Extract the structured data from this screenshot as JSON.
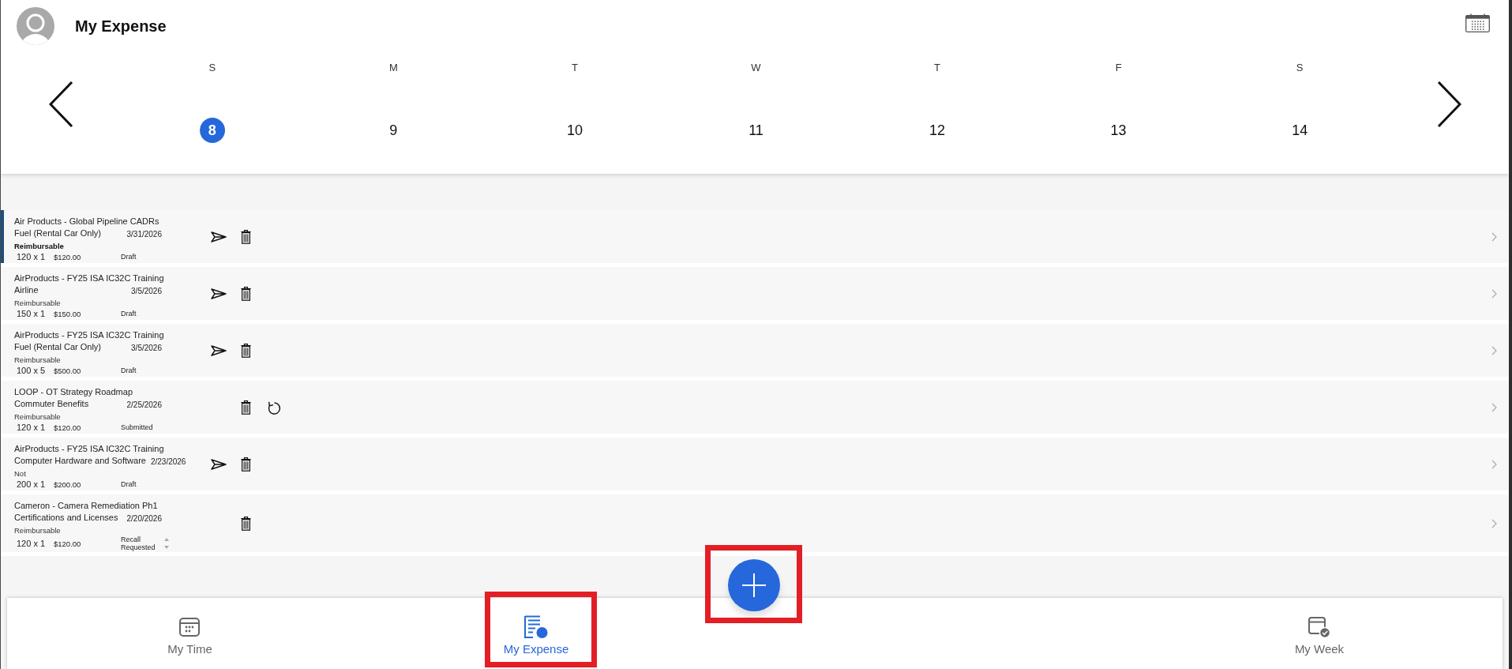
{
  "header": {
    "title": "My Expense"
  },
  "week": {
    "days": [
      {
        "letter": "S",
        "date": "8",
        "selected": true
      },
      {
        "letter": "M",
        "date": "9",
        "selected": false
      },
      {
        "letter": "T",
        "date": "10",
        "selected": false
      },
      {
        "letter": "W",
        "date": "11",
        "selected": false
      },
      {
        "letter": "T",
        "date": "12",
        "selected": false
      },
      {
        "letter": "F",
        "date": "13",
        "selected": false
      },
      {
        "letter": "S",
        "date": "14",
        "selected": false
      }
    ]
  },
  "expenses": [
    {
      "project": "Air Products - Global Pipeline CADRs",
      "category": "Fuel (Rental Car Only)",
      "date": "3/31/2026",
      "type": "Reimbursable",
      "quantity": "120 x 1",
      "amount": "$120.00",
      "status": "Draft",
      "scrollable": false,
      "actions": [
        {
          "kind": "send"
        },
        {
          "kind": "delete"
        }
      ],
      "selected": true
    },
    {
      "project": "AirProducts - FY25 ISA IC32C Training",
      "category": "Airline",
      "date": "3/5/2026",
      "type": "Reimbursable",
      "quantity": "150 x 1",
      "amount": "$150.00",
      "status": "Draft",
      "scrollable": false,
      "actions": [
        {
          "kind": "send"
        },
        {
          "kind": "delete"
        }
      ],
      "selected": false
    },
    {
      "project": "AirProducts - FY25 ISA IC32C Training",
      "category": "Fuel (Rental Car Only)",
      "date": "3/5/2026",
      "type": "Reimbursable",
      "quantity": "100 x 5",
      "amount": "$500.00",
      "status": "Draft",
      "scrollable": false,
      "actions": [
        {
          "kind": "send"
        },
        {
          "kind": "delete"
        }
      ],
      "selected": false
    },
    {
      "project": "LOOP - OT Strategy Roadmap",
      "category": "Commuter Benefits",
      "date": "2/25/2026",
      "type": "Reimbursable",
      "quantity": "120 x 1",
      "amount": "$120.00",
      "status": "Submitted",
      "scrollable": false,
      "actions": [
        {
          "kind": "delete"
        },
        {
          "kind": "undo"
        }
      ],
      "selected": false
    },
    {
      "project": "AirProducts - FY25 ISA IC32C Training",
      "category": "Computer Hardware and Software",
      "date": "2/23/2026",
      "type": "Not",
      "quantity": "200 x 1",
      "amount": "$200.00",
      "status": "Draft",
      "scrollable": false,
      "actions": [
        {
          "kind": "send"
        },
        {
          "kind": "delete"
        }
      ],
      "selected": false
    },
    {
      "project": "Cameron - Camera Remediation Ph1",
      "category": "Certifications and Licenses",
      "date": "2/20/2026",
      "type": "Reimbursable",
      "quantity": "120 x 1",
      "amount": "$120.00",
      "status": "Recall Requested",
      "scrollable": true,
      "actions": [
        {
          "kind": "delete"
        }
      ],
      "selected": false
    }
  ],
  "add_button": {
    "highlighted": true
  },
  "nav_tabs": [
    {
      "kind": "time",
      "label": "My Time",
      "selected": false,
      "highlighted": false
    },
    {
      "kind": "expense",
      "label": "My Expense",
      "selected": true,
      "highlighted": true
    },
    {
      "kind": "week",
      "label": "My Week",
      "selected": false,
      "highlighted": false
    }
  ]
}
